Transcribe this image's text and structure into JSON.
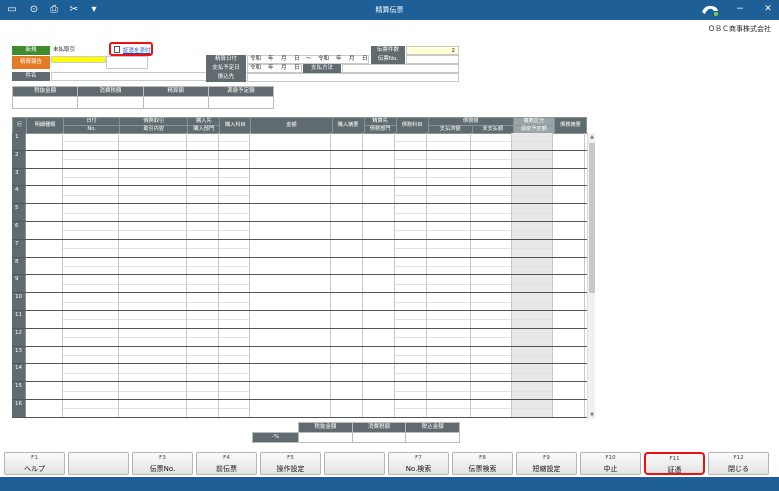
{
  "window": {
    "title": "精算伝票",
    "company": "ＯＢＣ商事株式会社",
    "toolbar_icons": [
      "window-icon",
      "zoom-icon",
      "print-icon",
      "tools-icon",
      "dropdown-icon"
    ]
  },
  "header": {
    "new_label": "新規",
    "tx_type": "未払取引",
    "applicant_label": "精算報告",
    "subject_label": "件名",
    "voucher_link": "証憑を添付",
    "settle_date_label": "精算日付",
    "pay_due_label": "支払予定日",
    "transfer_label": "振込先",
    "era": "令和",
    "year": "年",
    "month": "月",
    "day": "日",
    "tilde": "〜",
    "pay_method_label": "支払方法",
    "voucher_count_label": "伝票件数",
    "voucher_count_value": "2",
    "voucher_no_label": "伝票No."
  },
  "summary": {
    "headers": [
      "税抜金額",
      "消費税額",
      "精算額",
      "源泉予定額"
    ]
  },
  "grid": {
    "row_label": "行",
    "headers": {
      "detail_type": "明細種類",
      "date": "日付",
      "no": "No.",
      "claim": "債務取引",
      "tx_content": "取引内容",
      "buyer": "購入先",
      "buyer_dept": "購入部門",
      "buy_account": "購入科目",
      "amount": "金額",
      "buy_summary": "購入摘要",
      "settle_to": "精算先",
      "claim_dept": "債務部門",
      "claim_account": "債務科目",
      "claim_amount": "債務額",
      "paid": "支払済額",
      "unpaid": "未支払額",
      "tax_class": "複数区分",
      "withhold": "源泉予定額",
      "claim_summary": "債務摘要"
    },
    "row_numbers": [
      "1",
      "2",
      "3",
      "4",
      "5",
      "6",
      "7",
      "8",
      "9",
      "10",
      "11",
      "12",
      "13",
      "14",
      "15",
      "16"
    ]
  },
  "footer_total": {
    "headers": [
      "税抜金額",
      "消費税額",
      "税込金額"
    ],
    "rate": "-%"
  },
  "function_keys": [
    {
      "fn": "F1",
      "label": "ヘルプ"
    },
    {
      "fn": "",
      "label": ""
    },
    {
      "fn": "F3",
      "label": "伝票No."
    },
    {
      "fn": "F4",
      "label": "前伝票"
    },
    {
      "fn": "F5",
      "label": "操作設定"
    },
    {
      "fn": "",
      "label": ""
    },
    {
      "fn": "F7",
      "label": "No.検索"
    },
    {
      "fn": "F8",
      "label": "伝票検索"
    },
    {
      "fn": "F9",
      "label": "短縮設定"
    },
    {
      "fn": "F10",
      "label": "中止"
    },
    {
      "fn": "F11",
      "label": "証憑"
    },
    {
      "fn": "F12",
      "label": "閉じる"
    }
  ]
}
